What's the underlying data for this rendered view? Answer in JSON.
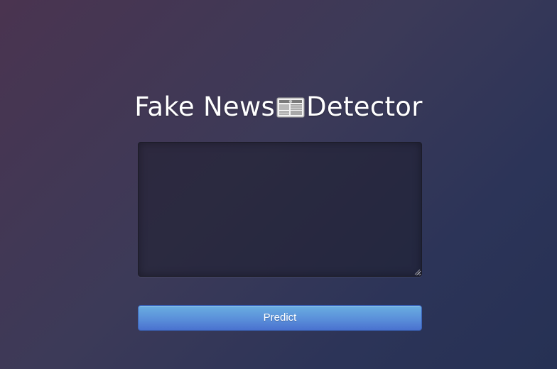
{
  "header": {
    "title_part1": "Fake News",
    "title_icon": "newspaper-icon",
    "title_part2": " Detector"
  },
  "form": {
    "textarea_value": "",
    "predict_label": "Predict"
  },
  "colors": {
    "background_start": "#4a3450",
    "background_end": "#263154",
    "button_top": "#6aaee0",
    "button_bottom": "#4a72cf"
  }
}
